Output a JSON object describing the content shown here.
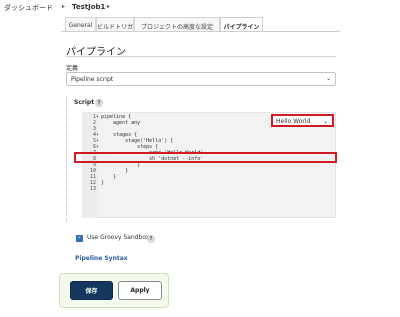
{
  "breadcrumb": {
    "items": [
      "ダッシュボード",
      "TestJob1"
    ],
    "separator": "▸"
  },
  "tabs": [
    {
      "label": "General",
      "active": false
    },
    {
      "label": "ビルドトリガ",
      "active": false
    },
    {
      "label": "プロジェクトの高度な設定",
      "active": false
    },
    {
      "label": "パイプライン",
      "active": true
    }
  ],
  "pipeline": {
    "title": "パイプライン",
    "definition_label": "定義",
    "definition_value": "Pipeline script",
    "script_label": "Script",
    "help_glyph": "?",
    "sample_select_value": "Hello World",
    "line_numbers": [
      "1",
      "2",
      "3",
      "4",
      "5",
      "6",
      "7",
      "8",
      "9",
      "10",
      "11",
      "12",
      "13"
    ],
    "code_lines": [
      "pipeline {",
      "    agent any",
      "",
      "    stages {",
      "        stage('Hello') {",
      "            steps {",
      "                echo 'Hello World'",
      "                sh 'dotnet --info'",
      "            }",
      "        }",
      "    }",
      "}",
      ""
    ],
    "fold_markers": [
      "▾",
      "",
      "",
      "▾",
      "▾",
      "▾",
      "",
      "",
      "",
      "",
      "",
      "",
      ""
    ],
    "highlighted_line_index": 7,
    "groovy_sandbox_label": "Use Groovy Sandbox",
    "groovy_sandbox_checked": true,
    "pipeline_syntax_link": "Pipeline Syntax"
  },
  "actions": {
    "save_label": "保存",
    "apply_label": "Apply"
  },
  "colors": {
    "accent": "#16385f",
    "highlight": "#d11b24",
    "link": "#2a5b9c",
    "checkbox": "#2c6fb5"
  }
}
